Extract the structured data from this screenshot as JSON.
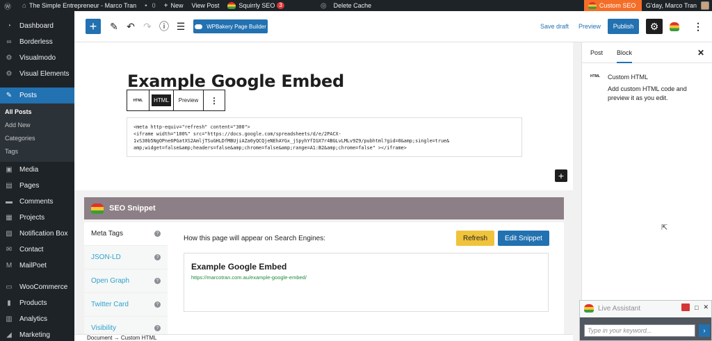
{
  "admin_bar": {
    "site_name": "The Simple Entrepreneur - Marco Tran",
    "comments_count": "0",
    "new_label": "New",
    "view_post_label": "View Post",
    "squirrly_label": "Squirrly SEO",
    "squirrly_count": "3",
    "delete_cache_label": "Delete Cache",
    "custom_seo_label": "Custom SEO",
    "greeting": "G'day, Marco Tran"
  },
  "sidebar": {
    "items": [
      {
        "label": "Dashboard",
        "icon": "dashboard-icon"
      },
      {
        "label": "Borderless",
        "icon": "infinity-icon"
      },
      {
        "label": "Visualmodo",
        "icon": "gear-icon"
      },
      {
        "label": "Visual Elements",
        "icon": "gear-icon"
      },
      {
        "label": "Posts",
        "icon": "pin-icon"
      },
      {
        "label": "Media",
        "icon": "media-icon"
      },
      {
        "label": "Pages",
        "icon": "page-icon"
      },
      {
        "label": "Comments",
        "icon": "comment-icon"
      },
      {
        "label": "Projects",
        "icon": "portfolio-icon"
      },
      {
        "label": "Notification Box",
        "icon": "notification-icon"
      },
      {
        "label": "Contact",
        "icon": "mail-icon"
      },
      {
        "label": "MailPoet",
        "icon": "mailpoet-icon"
      },
      {
        "label": "WooCommerce",
        "icon": "woo-icon"
      },
      {
        "label": "Products",
        "icon": "product-icon"
      },
      {
        "label": "Analytics",
        "icon": "analytics-icon"
      },
      {
        "label": "Marketing",
        "icon": "megaphone-icon"
      }
    ],
    "posts_submenu": [
      "All Posts",
      "Add New",
      "Categories",
      "Tags"
    ]
  },
  "toolbar": {
    "wpbakery_label": "WPBakery Page Builder",
    "save_draft_label": "Save draft",
    "preview_label": "Preview",
    "publish_label": "Publish"
  },
  "editor": {
    "title": "Example Google Embed",
    "block_toolbar": {
      "type_label": "HTML",
      "html_tab": "HTML",
      "preview_tab": "Preview"
    },
    "code_lines": [
      "<meta http-equiv=\"refresh\" content=\"300\">",
      "<iframe width=\"100%\" src=\"https://docs.google.com/spreadsheets/d/e/2PACX-",
      "1vS30b5NgOPne6PGatXS2AmljTSuGHLDfMBUjiAZa0yQCQjeNEhAYGx_jSpyhYfIGX7r4BGLvLMLv9Z9/pubhtml?gid=0&amp;single=true&",
      "amp;widget=false&amp;headers=false&amp;chrome=false&amp;range=A1:B2&amp;chrome=false\" ></iframe>"
    ]
  },
  "seo_snippet": {
    "header": "SEO Snippet",
    "tabs": [
      "Meta Tags",
      "JSON-LD",
      "Open Graph",
      "Twitter Card",
      "Visibility"
    ],
    "caption": "How this page will appear on Search Engines:",
    "refresh_label": "Refresh",
    "edit_label": "Edit Snippet",
    "preview_title": "Example Google Embed",
    "preview_url": "https://marcotran.com.au/example-google-embed/"
  },
  "statusbar": {
    "text": "Document  →  Custom HTML"
  },
  "panel": {
    "tab_post": "Post",
    "tab_block": "Block",
    "block_icon_label": "HTML",
    "block_name": "Custom HTML",
    "block_description": "Add custom HTML code and preview it as you edit."
  },
  "assistant": {
    "title": "Live Assistant",
    "placeholder": "Type in your keyword..."
  },
  "colors": {
    "admin_dark": "#1d2327",
    "accent_blue": "#2271b1",
    "custom_seo_orange": "#f56e28",
    "snippet_header": "#8c7f86",
    "refresh_yellow": "#f0c33c"
  }
}
